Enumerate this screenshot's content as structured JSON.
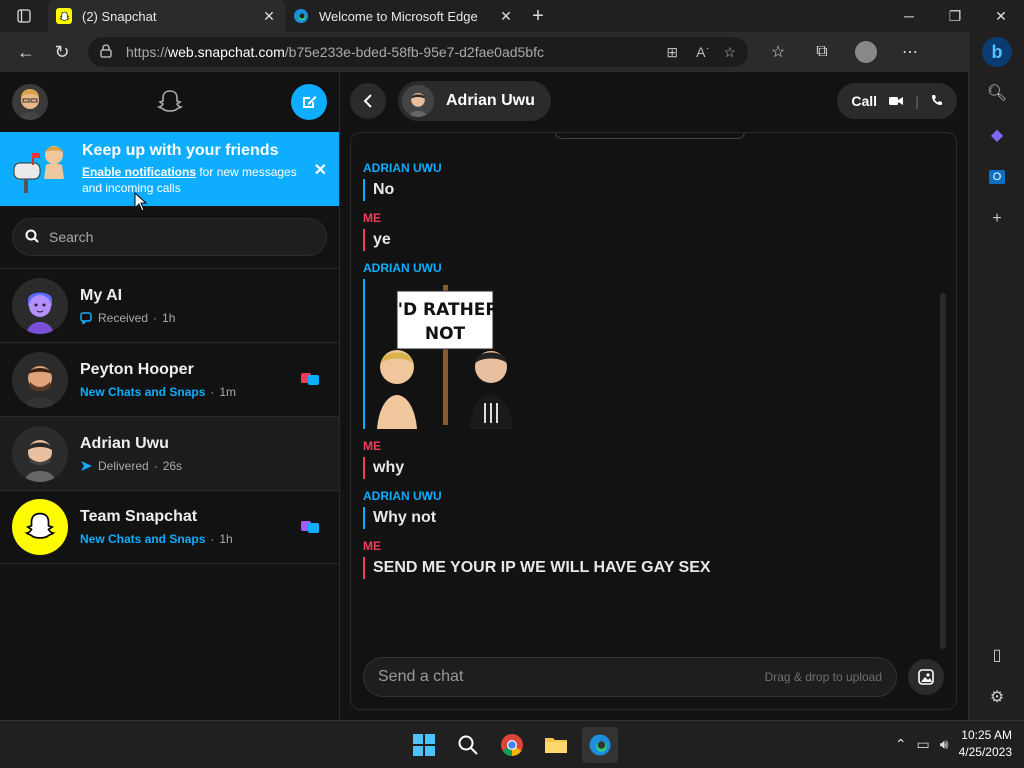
{
  "browser": {
    "tabs": [
      {
        "title": "(2) Snapchat",
        "active": true
      },
      {
        "title": "Welcome to Microsoft Edge",
        "active": false
      }
    ],
    "address": {
      "prefix": "https://",
      "host": "web.snapchat.com",
      "path": "/b75e233e-bded-58fb-95e7-d2fae0ad5bfc"
    }
  },
  "banner": {
    "title": "Keep up with your friends",
    "link": "Enable notifications",
    "rest": " for new messages and incoming calls"
  },
  "search": {
    "placeholder": "Search"
  },
  "conversations": [
    {
      "name": "My AI",
      "status": "Received",
      "time": "1h",
      "status_color": "grey"
    },
    {
      "name": "Peyton Hooper",
      "status": "New Chats and Snaps",
      "time": "1m",
      "status_color": "blue"
    },
    {
      "name": "Adrian Uwu",
      "status": "Delivered",
      "time": "26s",
      "status_color": "grey"
    },
    {
      "name": "Team Snapchat",
      "status": "New Chats and Snaps",
      "time": "1h",
      "status_color": "blue"
    }
  ],
  "chat": {
    "contact": "Adrian Uwu",
    "call_label": "Call",
    "messages": [
      {
        "sender": "ADRIAN UWU",
        "who": "them",
        "text": "No"
      },
      {
        "sender": "ME",
        "who": "me",
        "text": "ye"
      },
      {
        "sender": "ADRIAN UWU",
        "who": "them",
        "sticker_text": "I'D RATHER NOT"
      },
      {
        "sender": "ME",
        "who": "me",
        "text": "why"
      },
      {
        "sender": "ADRIAN UWU",
        "who": "them",
        "text": "Why not"
      },
      {
        "sender": "ME",
        "who": "me",
        "text": "SEND ME YOUR IP WE WILL HAVE GAY SEX"
      }
    ],
    "composer_placeholder": "Send a chat",
    "drag_hint": "Drag & drop to upload"
  },
  "taskbar": {
    "time": "10:25 AM",
    "date": "4/25/2023"
  },
  "colors": {
    "snap_blue": "#0fadff",
    "snap_red": "#f23c57",
    "snap_yellow": "#fffc00"
  }
}
